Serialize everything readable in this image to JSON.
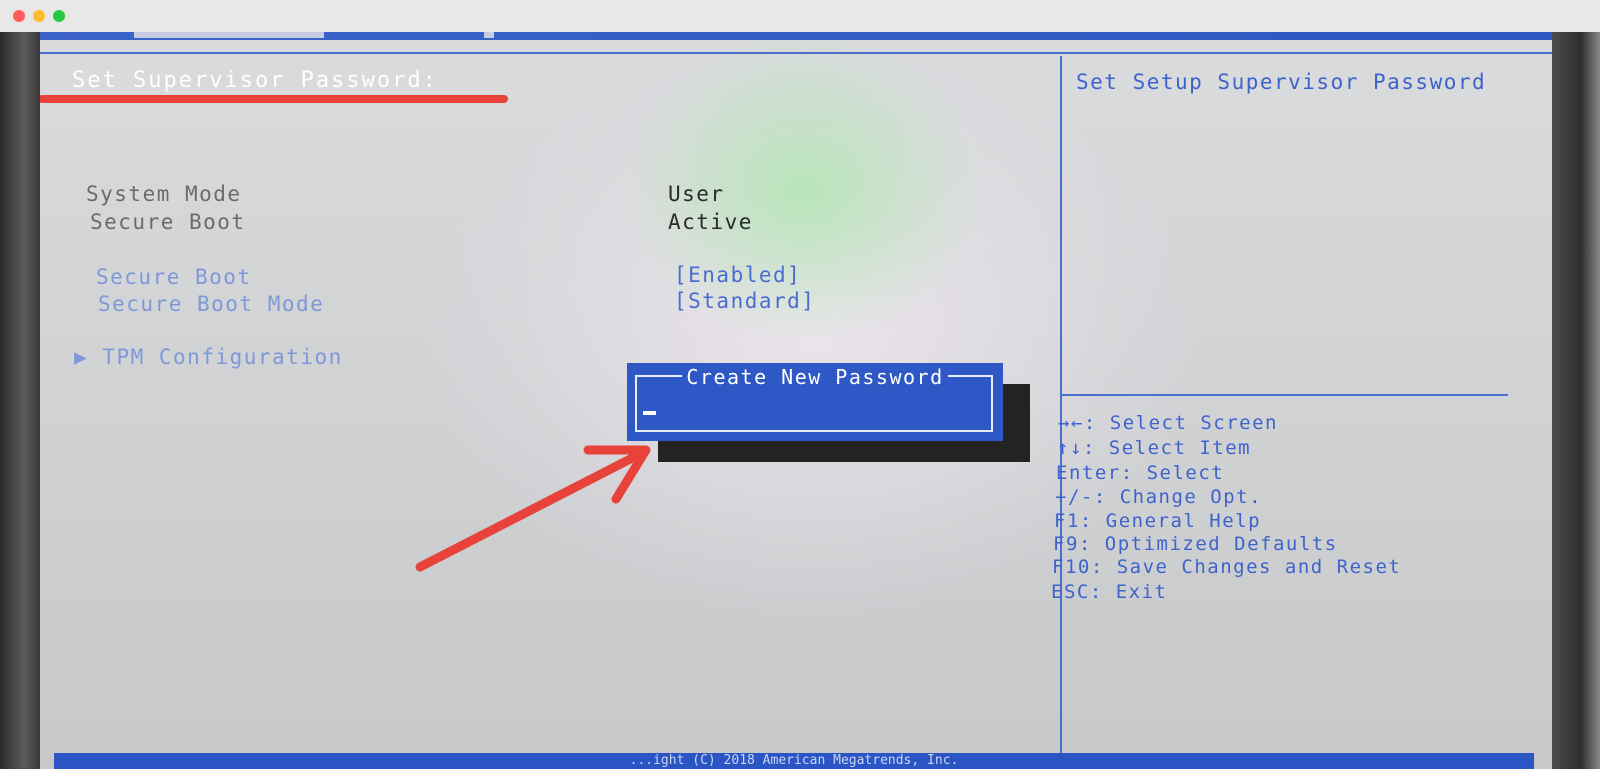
{
  "header": {
    "title": "Set Supervisor Password:"
  },
  "main": {
    "items": [
      {
        "label": "System Mode",
        "value": "User"
      },
      {
        "label": "Secure Boot",
        "value": "Active"
      },
      {
        "label": "Secure Boot",
        "value": "[Enabled]"
      },
      {
        "label": "Secure Boot Mode",
        "value": "[Standard]"
      }
    ],
    "submenu": {
      "arrow": "▶",
      "label": "TPM Configuration"
    }
  },
  "dialog": {
    "title": "Create New Password",
    "input_value": ""
  },
  "help": {
    "description": "Set Setup Supervisor Password",
    "keys": [
      "→←: Select Screen",
      "↑↓: Select Item",
      "Enter: Select",
      "+/-: Change Opt.",
      "F1: General Help",
      "F9: Optimized Defaults",
      "F10: Save Changes and Reset",
      "ESC: Exit"
    ]
  },
  "footer": {
    "text": "...ight (C) 2018 American Megatrends, Inc."
  },
  "colors": {
    "bios_blue": "#2d58c6",
    "annotation_red": "#e8433a",
    "screen_gray": "#d2d4d6"
  },
  "icons": {
    "submenu": "triangle-right-icon",
    "annotation": "red-arrow-icon"
  }
}
